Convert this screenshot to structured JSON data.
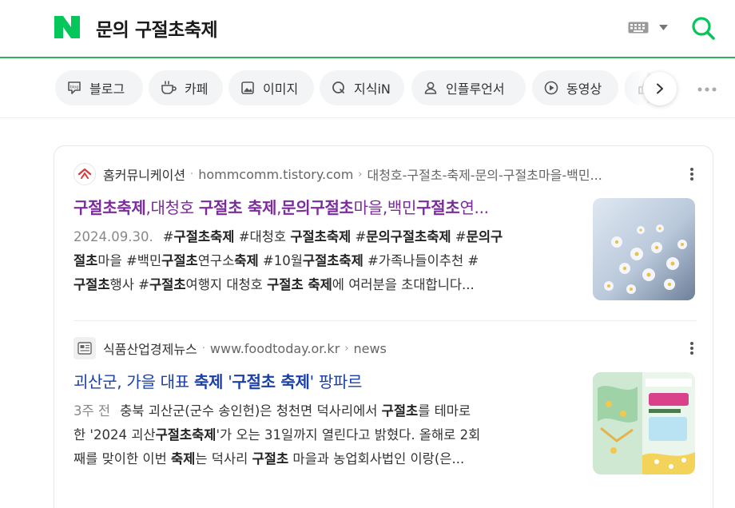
{
  "header": {
    "query": "문의 구절초축제"
  },
  "tabs": [
    {
      "label": "블로그",
      "icon": "blog-icon"
    },
    {
      "label": "카페",
      "icon": "cafe-icon"
    },
    {
      "label": "이미지",
      "icon": "image-icon"
    },
    {
      "label": "지식iN",
      "icon": "kin-icon"
    },
    {
      "label": "인플루언서",
      "icon": "influencer-icon"
    },
    {
      "label": "동영상",
      "icon": "video-icon"
    }
  ],
  "results": [
    {
      "source_name": "홈커뮤니케이션",
      "source_url": "hommcomm.tistory.com",
      "source_path": "대청호-구절초-축제-문의-구절초마을-백민...",
      "title_parts": [
        "구절초축제",
        ",대청호 ",
        "구절초 축제",
        ",",
        "문의구절초",
        "마을,백민",
        "구절초",
        "연..."
      ],
      "date": "2024.09.30.",
      "snippet_lines": [
        [
          "#",
          "구절초축제",
          " #대청호 ",
          "구절초축제",
          " #",
          "문의구절초축제",
          " #",
          "문의구"
        ],
        [
          "절초",
          "마을 #백민",
          "구절초",
          "연구소",
          "축제",
          " #10월",
          "구절초축제",
          " #가족나들이추천 #"
        ],
        [
          "구절초",
          "행사 #",
          "구절초",
          "여행지 대청호 ",
          "구절초 축제",
          "에 여러분을 초대합니다..."
        ]
      ]
    },
    {
      "source_name": "식품산업경제뉴스",
      "source_url": "www.foodtoday.or.kr",
      "source_path": "news",
      "title_parts": [
        "괴산군, 가을 대표 ",
        "축제",
        " '",
        "구절초 축제",
        "' 팡파르"
      ],
      "date": "3주 전",
      "snippet_lines": [
        [
          "충북 괴산군(군수 송인헌)은 청천면 덕사리에서 ",
          "구절초",
          "를 테마로"
        ],
        [
          "한 '2024 괴산",
          "구절초축제",
          "'가 오는 31일까지 열린다고 밝혔다. 올해로 2회"
        ],
        [
          "째를 맞이한 이번 ",
          "축제",
          "는 덕사리 ",
          "구절초",
          " 마을과 농업회사법인 이랑(은..."
        ]
      ]
    }
  ],
  "colors": {
    "brand": "#03c75a",
    "visited": "#7b2b9c",
    "link": "#1a3fa8"
  }
}
